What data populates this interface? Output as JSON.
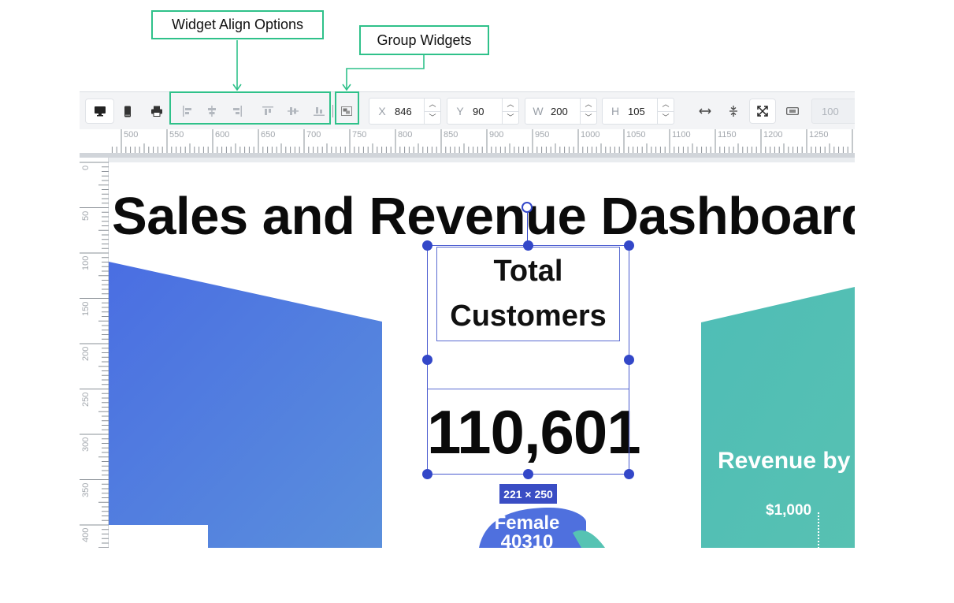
{
  "annotations": {
    "align_label": "Widget Align Options",
    "group_label": "Group Widgets"
  },
  "toolbar": {
    "device_buttons": [
      "desktop",
      "mobile"
    ],
    "fields": [
      {
        "label": "X",
        "value": "846"
      },
      {
        "label": "Y",
        "value": "90"
      },
      {
        "label": "W",
        "value": "200"
      },
      {
        "label": "H",
        "value": "105"
      }
    ],
    "zoom_value": "100"
  },
  "ruler": {
    "horizontal_labels": [
      "500",
      "550",
      "600",
      "650",
      "700",
      "750",
      "800",
      "850",
      "900",
      "950",
      "1000",
      "1050",
      "1100",
      "1150",
      "1200",
      "1250"
    ],
    "vertical_labels": [
      "0",
      "50",
      "100",
      "150",
      "200",
      "250",
      "300",
      "350",
      "400"
    ]
  },
  "canvas": {
    "title": "Sales and Revenue Dashboard",
    "widget_title_line1": "Total",
    "widget_title_line2": "Customers",
    "widget_value": "110,601",
    "size_tag": "221 × 250",
    "female_label": "Female",
    "female_value": "40310",
    "revenue_title": "Revenue by Country",
    "revenue_axis_label": "$1,000"
  },
  "colors": {
    "annotation_green": "#2fc18a",
    "selection_blue": "#3347c8",
    "left_panel_blue": "#4f73e0",
    "right_panel_teal": "#4dbfb6"
  }
}
